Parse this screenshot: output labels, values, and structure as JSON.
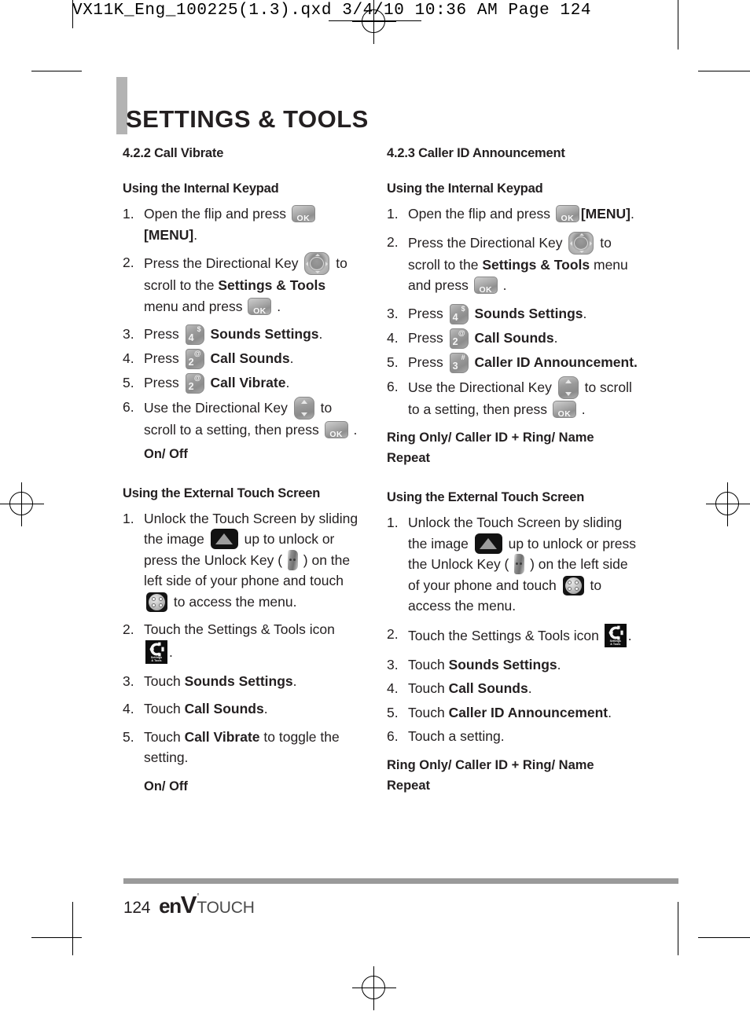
{
  "prepress": {
    "header_line": "VX11K_Eng_100225(1.3).qxd  3/4/10  10:36 AM  Page 124"
  },
  "page": {
    "title": "SETTINGS & TOOLS",
    "number": "124",
    "brand": {
      "env": "en",
      "v": "V",
      "tm": "°",
      "touch": "TOUCH"
    }
  },
  "left_column": {
    "section_number_title": "4.2.2 Call Vibrate",
    "internal_keypad": {
      "heading": "Using the Internal Keypad",
      "steps": [
        {
          "num": "1.",
          "parts": [
            {
              "type": "text",
              "value": "Open the flip and press "
            },
            {
              "type": "icon",
              "icon": "ok-key-icon",
              "label": "OK"
            },
            {
              "type": "bold",
              "value": " [MENU]"
            },
            {
              "type": "text",
              "value": "."
            }
          ]
        },
        {
          "num": "2.",
          "parts": [
            {
              "type": "text",
              "value": "Press the Directional Key "
            },
            {
              "type": "icon",
              "icon": "directional-key-4way-icon"
            },
            {
              "type": "text",
              "value": " to scroll to the "
            },
            {
              "type": "bold",
              "value": "Settings & Tools"
            },
            {
              "type": "text",
              "value": " menu and press "
            },
            {
              "type": "icon",
              "icon": "ok-key-icon",
              "label": "OK"
            },
            {
              "type": "text",
              "value": " ."
            }
          ]
        },
        {
          "num": "3.",
          "parts": [
            {
              "type": "text",
              "value": "Press "
            },
            {
              "type": "icon",
              "icon": "keypad-key-4-icon",
              "digit": "4",
              "sup": "$"
            },
            {
              "type": "bold",
              "value": " Sounds Settings"
            },
            {
              "type": "text",
              "value": "."
            }
          ]
        },
        {
          "num": "4.",
          "parts": [
            {
              "type": "text",
              "value": "Press "
            },
            {
              "type": "icon",
              "icon": "keypad-key-2-icon",
              "digit": "2",
              "sup": "@"
            },
            {
              "type": "bold",
              "value": " Call Sounds"
            },
            {
              "type": "text",
              "value": "."
            }
          ]
        },
        {
          "num": "5.",
          "parts": [
            {
              "type": "text",
              "value": "Press "
            },
            {
              "type": "icon",
              "icon": "keypad-key-2-icon",
              "digit": "2",
              "sup": "@"
            },
            {
              "type": "bold",
              "value": " Call Vibrate"
            },
            {
              "type": "text",
              "value": "."
            }
          ]
        },
        {
          "num": "6.",
          "parts": [
            {
              "type": "text",
              "value": "Use the Directional Key "
            },
            {
              "type": "icon",
              "icon": "directional-key-updown-icon"
            },
            {
              "type": "text",
              "value": " to scroll to a setting, then press "
            },
            {
              "type": "icon",
              "icon": "ok-key-icon",
              "label": "OK"
            },
            {
              "type": "text",
              "value": " ."
            }
          ]
        }
      ],
      "options_note": "On/ Off"
    },
    "external_touch": {
      "heading": "Using the External Touch Screen",
      "steps": [
        {
          "num": "1.",
          "parts": [
            {
              "type": "text",
              "value": "Unlock the Touch Screen by sliding the image "
            },
            {
              "type": "icon",
              "icon": "unlock-slide-arrow-icon"
            },
            {
              "type": "text",
              "value": " up to unlock or press the Unlock Key ( "
            },
            {
              "type": "icon",
              "icon": "unlock-hardware-key-icon"
            },
            {
              "type": "text",
              "value": " ) on the left side of your phone and touch "
            },
            {
              "type": "icon",
              "icon": "menu-four-dots-icon"
            },
            {
              "type": "text",
              "value": " to access the menu."
            }
          ]
        },
        {
          "num": "2.",
          "parts": [
            {
              "type": "text",
              "value": "Touch the Settings & Tools icon "
            },
            {
              "type": "icon",
              "icon": "settings-and-tools-app-icon",
              "caption": "Settings & Tools"
            },
            {
              "type": "text",
              "value": "."
            }
          ]
        },
        {
          "num": "3.",
          "parts": [
            {
              "type": "text",
              "value": "Touch "
            },
            {
              "type": "bold",
              "value": "Sounds Settings"
            },
            {
              "type": "text",
              "value": "."
            }
          ]
        },
        {
          "num": "4.",
          "parts": [
            {
              "type": "text",
              "value": "Touch "
            },
            {
              "type": "bold",
              "value": "Call Sounds"
            },
            {
              "type": "text",
              "value": "."
            }
          ]
        },
        {
          "num": "5.",
          "parts": [
            {
              "type": "text",
              "value": "Touch "
            },
            {
              "type": "bold",
              "value": "Call Vibrate"
            },
            {
              "type": "text",
              "value": " to toggle the setting."
            }
          ]
        }
      ],
      "options_note": "On/ Off"
    }
  },
  "right_column": {
    "section_number_title": "4.2.3 Caller ID Announcement",
    "internal_keypad": {
      "heading": "Using the Internal Keypad",
      "steps": [
        {
          "num": "1.",
          "parts": [
            {
              "type": "text",
              "value": "Open the flip and press "
            },
            {
              "type": "icon",
              "icon": "ok-key-icon",
              "label": "OK"
            },
            {
              "type": "bold",
              "value": " [MENU]"
            },
            {
              "type": "text",
              "value": "."
            }
          ]
        },
        {
          "num": "2.",
          "parts": [
            {
              "type": "text",
              "value": "Press the Directional Key "
            },
            {
              "type": "icon",
              "icon": "directional-key-4way-icon"
            },
            {
              "type": "text",
              "value": " to scroll to the "
            },
            {
              "type": "bold",
              "value": "Settings & Tools"
            },
            {
              "type": "text",
              "value": " menu and press "
            },
            {
              "type": "icon",
              "icon": "ok-key-icon",
              "label": "OK"
            },
            {
              "type": "text",
              "value": " ."
            }
          ]
        },
        {
          "num": "3.",
          "parts": [
            {
              "type": "text",
              "value": "Press "
            },
            {
              "type": "icon",
              "icon": "keypad-key-4-icon",
              "digit": "4",
              "sup": "$"
            },
            {
              "type": "bold",
              "value": " Sounds Settings"
            },
            {
              "type": "text",
              "value": "."
            }
          ]
        },
        {
          "num": "4.",
          "parts": [
            {
              "type": "text",
              "value": "Press "
            },
            {
              "type": "icon",
              "icon": "keypad-key-2-icon",
              "digit": "2",
              "sup": "@"
            },
            {
              "type": "bold",
              "value": " Call Sounds"
            },
            {
              "type": "text",
              "value": "."
            }
          ]
        },
        {
          "num": "5.",
          "parts": [
            {
              "type": "text",
              "value": "Press "
            },
            {
              "type": "icon",
              "icon": "keypad-key-3-icon",
              "digit": "3",
              "sup": "#"
            },
            {
              "type": "bold",
              "value": " Caller ID Announcement."
            }
          ]
        },
        {
          "num": "6.",
          "parts": [
            {
              "type": "text",
              "value": "Use the Directional Key "
            },
            {
              "type": "icon",
              "icon": "directional-key-updown-icon"
            },
            {
              "type": "text",
              "value": " to scroll to a setting, then press "
            },
            {
              "type": "icon",
              "icon": "ok-key-icon",
              "label": "OK"
            },
            {
              "type": "text",
              "value": " ."
            }
          ]
        }
      ],
      "options_note": "Ring Only/ Caller ID + Ring/ Name Repeat"
    },
    "external_touch": {
      "heading": "Using the External Touch Screen",
      "steps": [
        {
          "num": "1.",
          "parts": [
            {
              "type": "text",
              "value": "Unlock the Touch Screen by sliding the image "
            },
            {
              "type": "icon",
              "icon": "unlock-slide-arrow-icon"
            },
            {
              "type": "text",
              "value": " up to unlock or press the Unlock Key ( "
            },
            {
              "type": "icon",
              "icon": "unlock-hardware-key-icon"
            },
            {
              "type": "text",
              "value": " ) on the left side of your phone and touch "
            },
            {
              "type": "icon",
              "icon": "menu-four-dots-icon"
            },
            {
              "type": "text",
              "value": " to access the menu."
            }
          ]
        },
        {
          "num": "2.",
          "parts": [
            {
              "type": "text",
              "value": "Touch the Settings & Tools icon "
            },
            {
              "type": "icon",
              "icon": "settings-and-tools-app-icon",
              "caption": "Settings & Tools"
            },
            {
              "type": "text",
              "value": "."
            }
          ]
        },
        {
          "num": "3.",
          "parts": [
            {
              "type": "text",
              "value": "Touch "
            },
            {
              "type": "bold",
              "value": "Sounds Settings"
            },
            {
              "type": "text",
              "value": "."
            }
          ]
        },
        {
          "num": "4.",
          "parts": [
            {
              "type": "text",
              "value": "Touch "
            },
            {
              "type": "bold",
              "value": "Call Sounds"
            },
            {
              "type": "text",
              "value": "."
            }
          ]
        },
        {
          "num": "5.",
          "parts": [
            {
              "type": "text",
              "value": "Touch "
            },
            {
              "type": "bold",
              "value": "Caller ID Announcement"
            },
            {
              "type": "text",
              "value": "."
            }
          ]
        },
        {
          "num": "6.",
          "parts": [
            {
              "type": "text",
              "value": "Touch a setting."
            }
          ]
        }
      ],
      "options_note": "Ring Only/ Caller ID + Ring/ Name Repeat"
    }
  },
  "icon_captions": {
    "settings_tools_line1": "Settings",
    "settings_tools_line2": "& Tools"
  },
  "colors": {
    "text": "#231f20",
    "title_bar": "#b3b3b3",
    "footer_rule": "#9a9a9a",
    "key_face": "#9b9b9b"
  }
}
